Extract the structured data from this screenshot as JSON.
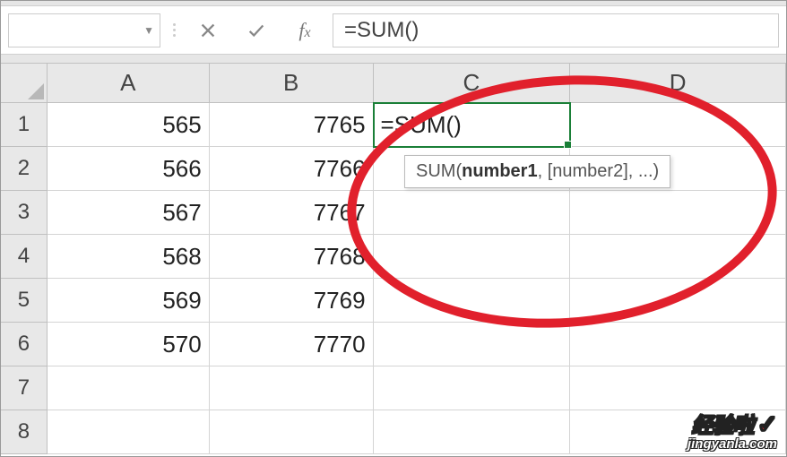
{
  "formula_bar": {
    "name_box": "",
    "formula": "=SUM()"
  },
  "columns": [
    "A",
    "B",
    "C",
    "D"
  ],
  "rows": [
    {
      "n": "1",
      "A": "565",
      "B": "7765",
      "C": "=SUM()",
      "D": ""
    },
    {
      "n": "2",
      "A": "566",
      "B": "7766",
      "C": "",
      "D": ""
    },
    {
      "n": "3",
      "A": "567",
      "B": "7767",
      "C": "",
      "D": ""
    },
    {
      "n": "4",
      "A": "568",
      "B": "7768",
      "C": "",
      "D": ""
    },
    {
      "n": "5",
      "A": "569",
      "B": "7769",
      "C": "",
      "D": ""
    },
    {
      "n": "6",
      "A": "570",
      "B": "7770",
      "C": "",
      "D": ""
    },
    {
      "n": "7",
      "A": "",
      "B": "",
      "C": "",
      "D": ""
    },
    {
      "n": "8",
      "A": "",
      "B": "",
      "C": "",
      "D": ""
    }
  ],
  "tooltip": {
    "fn": "SUM",
    "arg_bold": "number1",
    "rest": ", [number2], ...)"
  },
  "watermark": {
    "top": "经验啦",
    "url": "jingyanla.com"
  }
}
